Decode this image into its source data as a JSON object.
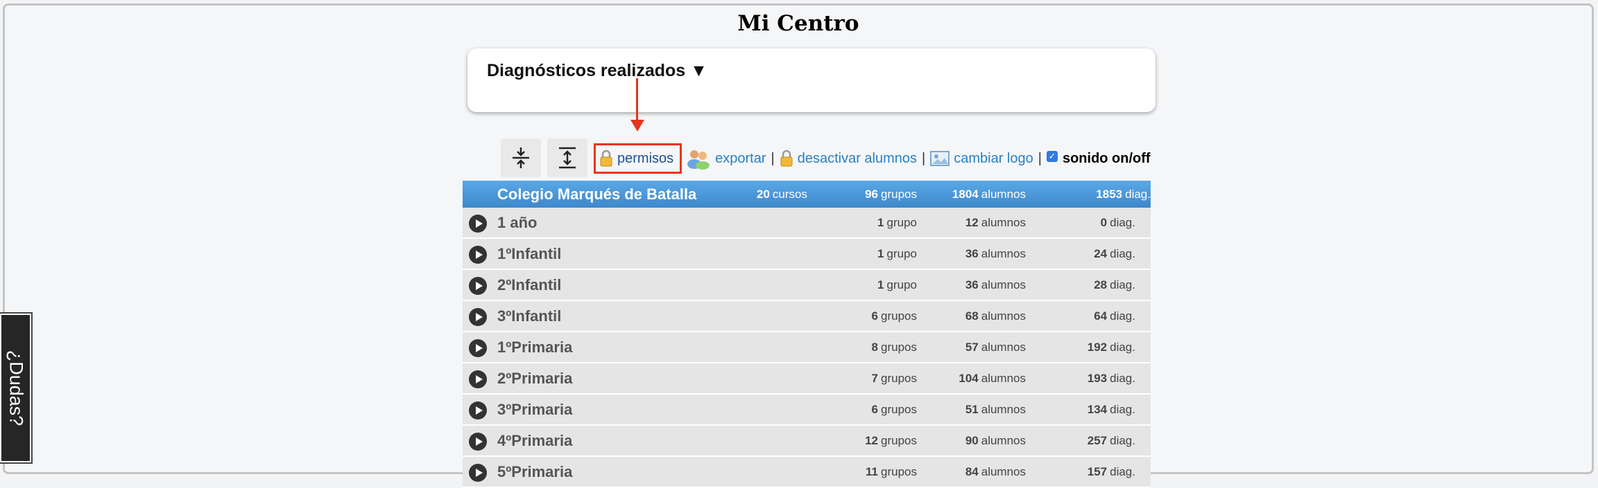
{
  "page": {
    "title": "Mi Centro"
  },
  "panel": {
    "title": "Diagnósticos realizados ▼"
  },
  "toolbar": {
    "collapse_icon": "collapse-icon",
    "expand_icon": "expand-icon",
    "permisos": "permisos",
    "exportar": "exportar",
    "desactivar": "desactivar alumnos",
    "cambiar_logo": "cambiar logo",
    "separator": "|",
    "sonido": "sonido on/off",
    "sonido_checked": true
  },
  "school": {
    "name": "Colegio Marqués de Batalla",
    "cursos": "20",
    "cursos_label": "cursos",
    "grupos": "96",
    "grupos_label": "grupos",
    "alumnos": "1804",
    "alumnos_label": "alumnos",
    "diag": "1853",
    "diag_label": "diag."
  },
  "rows": [
    {
      "name": "1 año",
      "grupos": "1",
      "grupos_label": "grupo",
      "alumnos": "12",
      "alumnos_label": "alumnos",
      "diag": "0",
      "diag_label": "diag."
    },
    {
      "name": "1ºInfantil",
      "grupos": "1",
      "grupos_label": "grupo",
      "alumnos": "36",
      "alumnos_label": "alumnos",
      "diag": "24",
      "diag_label": "diag."
    },
    {
      "name": "2ºInfantil",
      "grupos": "1",
      "grupos_label": "grupo",
      "alumnos": "36",
      "alumnos_label": "alumnos",
      "diag": "28",
      "diag_label": "diag."
    },
    {
      "name": "3ºInfantil",
      "grupos": "6",
      "grupos_label": "grupos",
      "alumnos": "68",
      "alumnos_label": "alumnos",
      "diag": "64",
      "diag_label": "diag."
    },
    {
      "name": "1ºPrimaria",
      "grupos": "8",
      "grupos_label": "grupos",
      "alumnos": "57",
      "alumnos_label": "alumnos",
      "diag": "192",
      "diag_label": "diag."
    },
    {
      "name": "2ºPrimaria",
      "grupos": "7",
      "grupos_label": "grupos",
      "alumnos": "104",
      "alumnos_label": "alumnos",
      "diag": "193",
      "diag_label": "diag."
    },
    {
      "name": "3ºPrimaria",
      "grupos": "6",
      "grupos_label": "grupos",
      "alumnos": "51",
      "alumnos_label": "alumnos",
      "diag": "134",
      "diag_label": "diag."
    },
    {
      "name": "4ºPrimaria",
      "grupos": "12",
      "grupos_label": "grupos",
      "alumnos": "90",
      "alumnos_label": "alumnos",
      "diag": "257",
      "diag_label": "diag."
    },
    {
      "name": "5ºPrimaria",
      "grupos": "11",
      "grupos_label": "grupos",
      "alumnos": "84",
      "alumnos_label": "alumnos",
      "diag": "157",
      "diag_label": "diag."
    }
  ],
  "help_tab": {
    "label": "¿Dudas?"
  },
  "colors": {
    "accent": "#2a80c1",
    "highlight": "#e8341e",
    "header": "#4a96d8"
  }
}
